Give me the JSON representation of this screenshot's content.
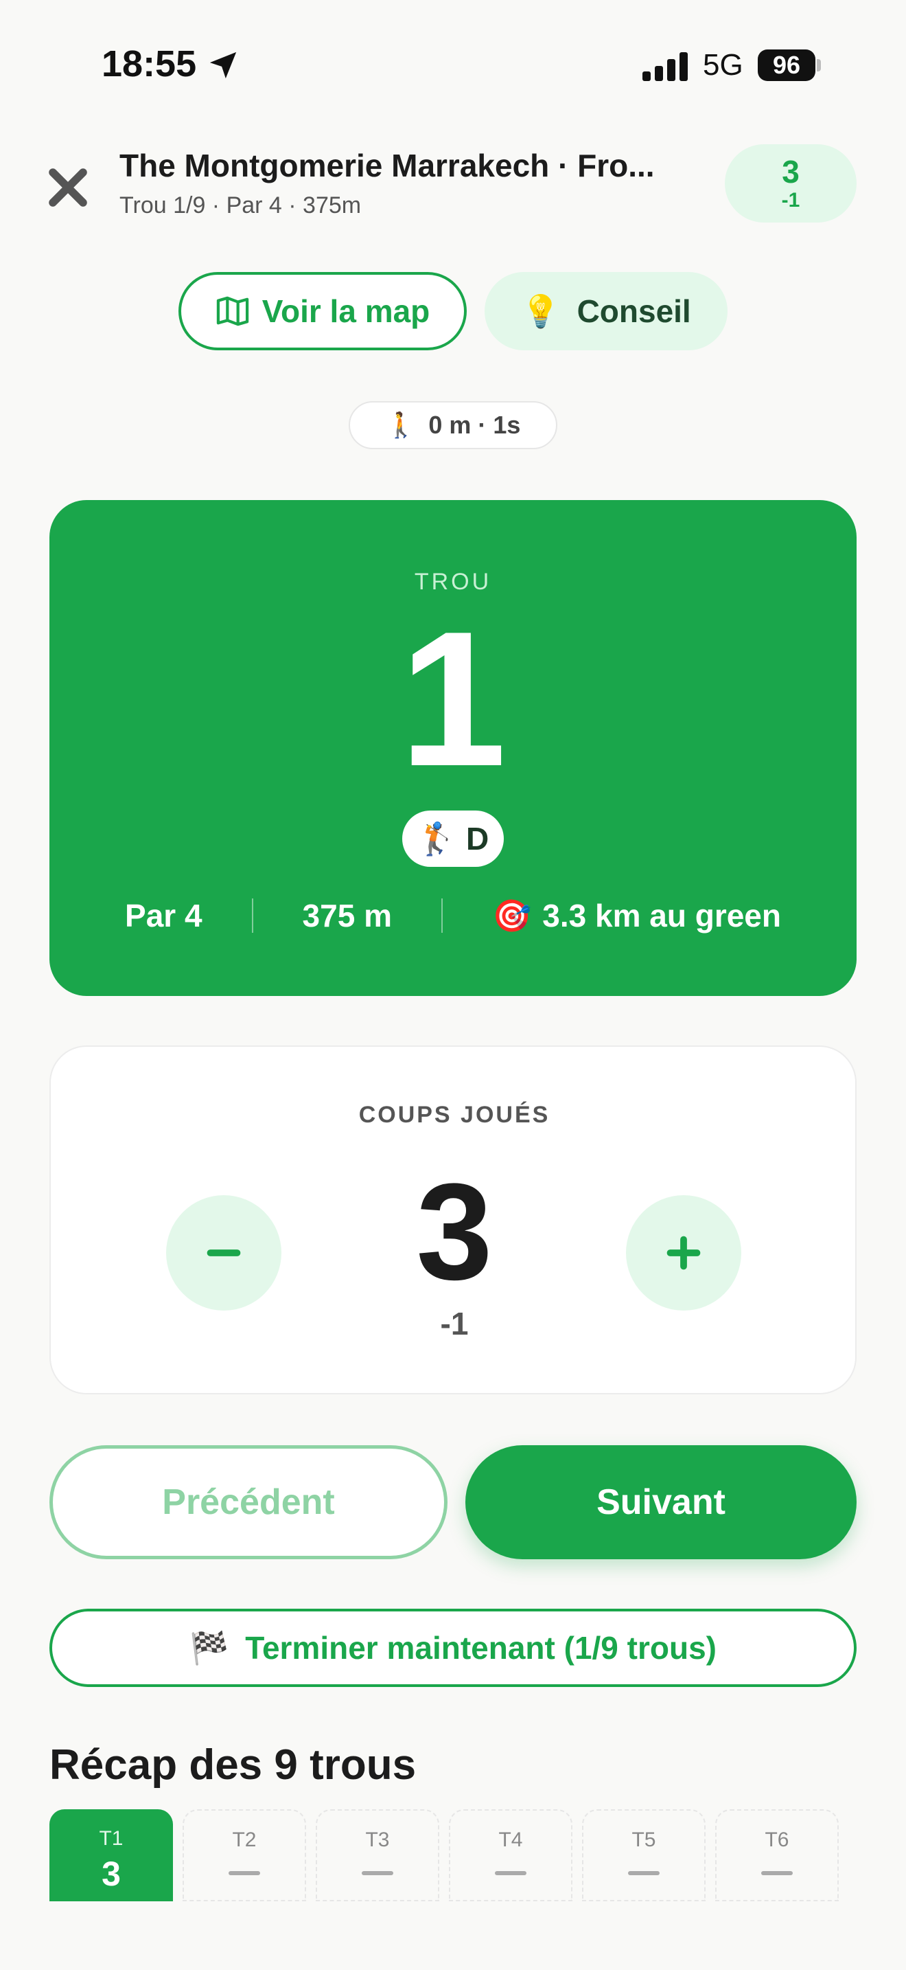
{
  "status_bar": {
    "time": "18:55",
    "network": "5G",
    "battery": "96",
    "icons": [
      "location-arrow-icon",
      "signal-icon"
    ]
  },
  "header": {
    "course_name": "The Montgomerie Marrakech · Fro...",
    "subtitle": "Trou 1/9 · Par 4 · 375m",
    "score": "3",
    "score_rel": "-1"
  },
  "actions": {
    "map_label": "Voir la map",
    "tip_label": "Conseil",
    "tip_icon": "💡"
  },
  "walk": {
    "icon": "🚶",
    "text": "0 m · 1s"
  },
  "hole_card": {
    "label": "TROU",
    "number": "1",
    "tee_icon": "🏌️",
    "tee": "D",
    "par": "Par 4",
    "distance": "375 m",
    "green_icon": "🎯",
    "to_green": "3.3 km au green",
    "bg_color": "#1aa64b"
  },
  "strokes": {
    "label": "COUPS JOUÉS",
    "value": "3",
    "relative": "-1"
  },
  "nav": {
    "prev": "Précédent",
    "next": "Suivant"
  },
  "finish": {
    "icon": "🏁",
    "label": "Terminer maintenant (1/9 trous)"
  },
  "recap": {
    "title": "Récap des 9 trous",
    "holes": [
      {
        "label": "T1",
        "value": "3"
      },
      {
        "label": "T2",
        "value": ""
      },
      {
        "label": "T3",
        "value": ""
      },
      {
        "label": "T4",
        "value": ""
      },
      {
        "label": "T5",
        "value": ""
      },
      {
        "label": "T6",
        "value": ""
      }
    ]
  }
}
